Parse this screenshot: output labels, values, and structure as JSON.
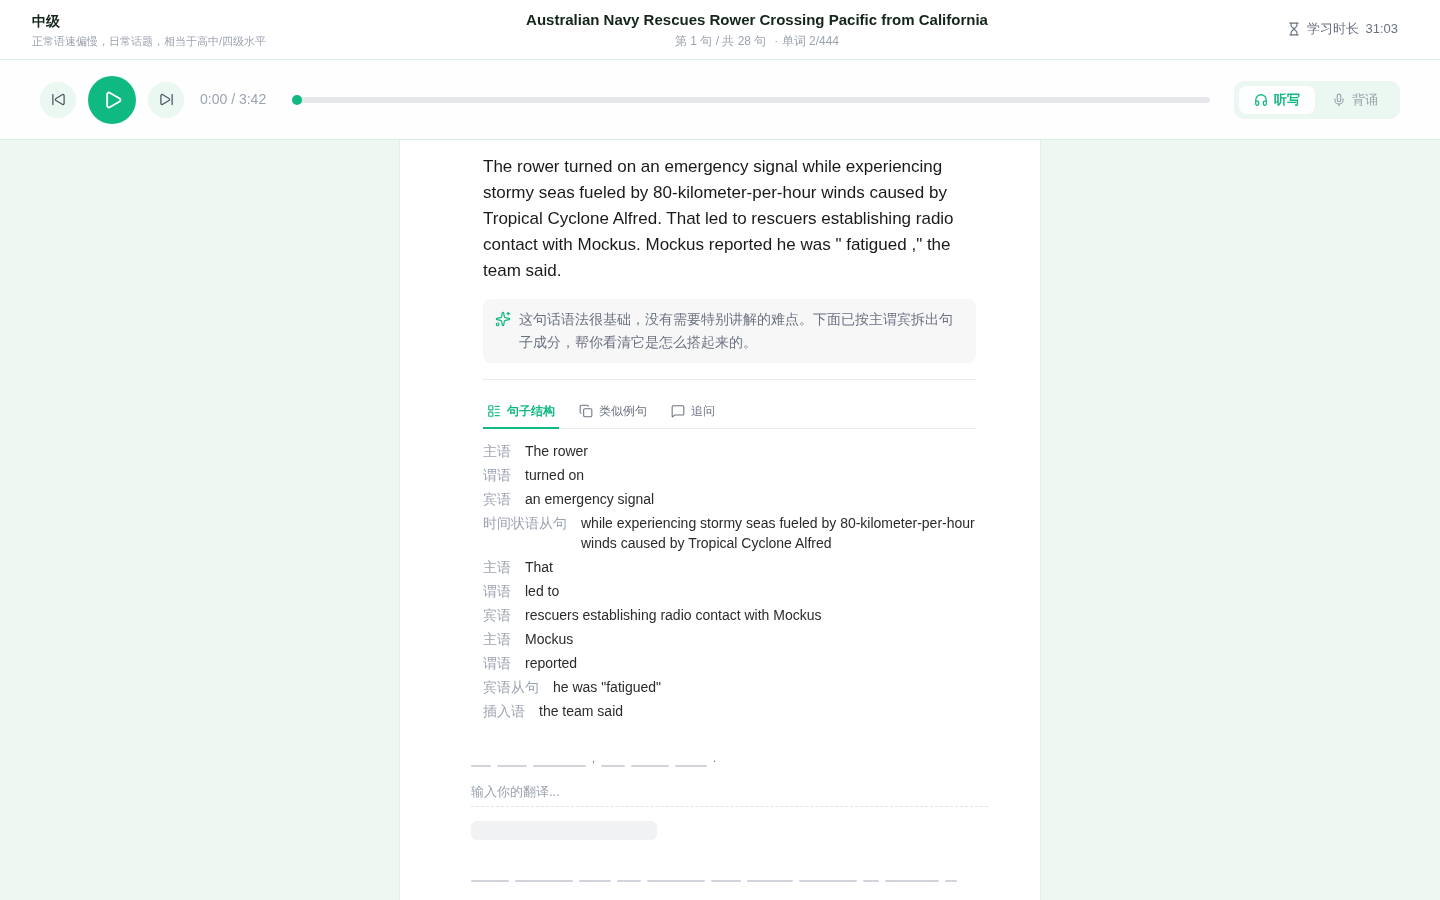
{
  "header": {
    "level": "中级",
    "level_description": "正常语速偏慢，日常话题，相当于高中/四级水平",
    "title": "Australian Navy Rescues Rower Crossing Pacific from California",
    "progress": "第 1 句 / 共 28 句",
    "word_count": "· 单词 2/444",
    "study_time_label": "学习时长",
    "study_time": "31:03"
  },
  "player": {
    "time": "0:00 / 3:42",
    "level": 0,
    "modes": [
      {
        "kind": "dictation",
        "label": "听写",
        "selected": true
      },
      {
        "kind": "recitation",
        "label": "背诵",
        "selected": false
      }
    ]
  },
  "sentence": "The rower turned on an emergency signal while experiencing stormy seas fueled by 80-kilometer-per-hour winds caused by Tropical Cyclone Alfred. That led to rescuers establishing radio contact with Mockus. Mockus reported he was \" fatigued ,\" the team said.",
  "hint": "这句话语法很基础，没有需要特别讲解的难点。下面已按主谓宾拆出句子成分，帮你看清它是怎么搭起来的。",
  "tabs": [
    {
      "kind": "structure",
      "label": "句子结构",
      "selected": true
    },
    {
      "kind": "examples",
      "label": "类似例句",
      "selected": false
    },
    {
      "kind": "ask",
      "label": "追问",
      "selected": false
    }
  ],
  "structure": [
    {
      "role": "主语",
      "text": "The rower"
    },
    {
      "role": "谓语",
      "text": "turned on"
    },
    {
      "role": "宾语",
      "text": "an emergency signal"
    },
    {
      "role": "时间状语从句",
      "text": "while experiencing stormy seas fueled by 80-kilometer-per-hour winds caused by Tropical Cyclone Alfred"
    },
    {
      "role": "主语",
      "text": "That"
    },
    {
      "role": "谓语",
      "text": "led to"
    },
    {
      "role": "宾语",
      "text": "rescuers establishing radio contact with Mockus"
    },
    {
      "role": "主语",
      "text": "Mockus"
    },
    {
      "role": "谓语",
      "text": "reported"
    },
    {
      "role": "宾语从句",
      "text": "he was \"fatigued\""
    },
    {
      "role": "插入语",
      "text": "the team said"
    }
  ],
  "word_blanks": [
    {
      "kind": "blank"
    },
    {
      "kind": "blank"
    },
    {
      "kind": "blank"
    },
    {
      "kind": "punct",
      "text": ","
    },
    {
      "kind": "blank"
    },
    {
      "kind": "blank"
    },
    {
      "kind": "blank"
    },
    {
      "kind": "punct",
      "text": "."
    }
  ],
  "translation": {
    "placeholder": "输入你的翻译..."
  },
  "next_blanks": [
    {
      "kind": "blank"
    },
    {
      "kind": "blank"
    },
    {
      "kind": "blank"
    },
    {
      "kind": "blank"
    },
    {
      "kind": "blank"
    },
    {
      "kind": "blank"
    },
    {
      "kind": "blank"
    },
    {
      "kind": "blank"
    },
    {
      "kind": "blank"
    },
    {
      "kind": "blank"
    },
    {
      "kind": "blank"
    }
  ]
}
